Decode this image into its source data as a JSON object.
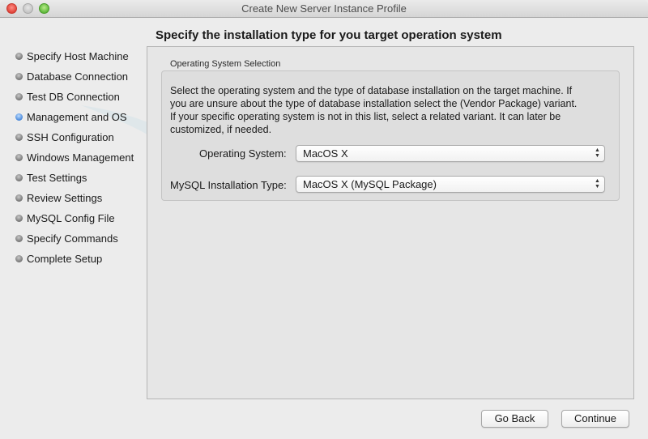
{
  "window": {
    "title": "Create New Server Instance Profile"
  },
  "sidebar": {
    "items": [
      {
        "label": "Specify Host Machine",
        "active": false
      },
      {
        "label": "Database Connection",
        "active": false
      },
      {
        "label": "Test DB Connection",
        "active": false
      },
      {
        "label": "Management and OS",
        "active": true
      },
      {
        "label": "SSH Configuration",
        "active": false
      },
      {
        "label": "Windows Management",
        "active": false
      },
      {
        "label": "Test Settings",
        "active": false
      },
      {
        "label": "Review Settings",
        "active": false
      },
      {
        "label": "MySQL Config File",
        "active": false
      },
      {
        "label": "Specify Commands",
        "active": false
      },
      {
        "label": "Complete Setup",
        "active": false
      }
    ]
  },
  "main": {
    "heading": "Specify the installation type for you target operation system",
    "group": {
      "label": "Operating System Selection",
      "description_lines": [
        "Select the operating system and the type of database installation on the target machine. If",
        "you are unsure about the type of database installation select the (Vendor Package) variant.",
        "If your specific operating system is not in this list, select a related variant. It can later be",
        "customized, if needed."
      ],
      "os_label": "Operating System:",
      "os_value": "MacOS X",
      "install_label": "MySQL Installation Type:",
      "install_value": "MacOS X (MySQL Package)"
    }
  },
  "footer": {
    "back_label": "Go Back",
    "continue_label": "Continue"
  },
  "colors": {
    "active_bullet": "#3d7fd6",
    "inactive_bullet": "#6f6f6f",
    "close": "#e0443a",
    "minimize": "#c4c4c4",
    "maximize": "#5fb93c"
  },
  "icons": {
    "arrows": "▲▼"
  }
}
